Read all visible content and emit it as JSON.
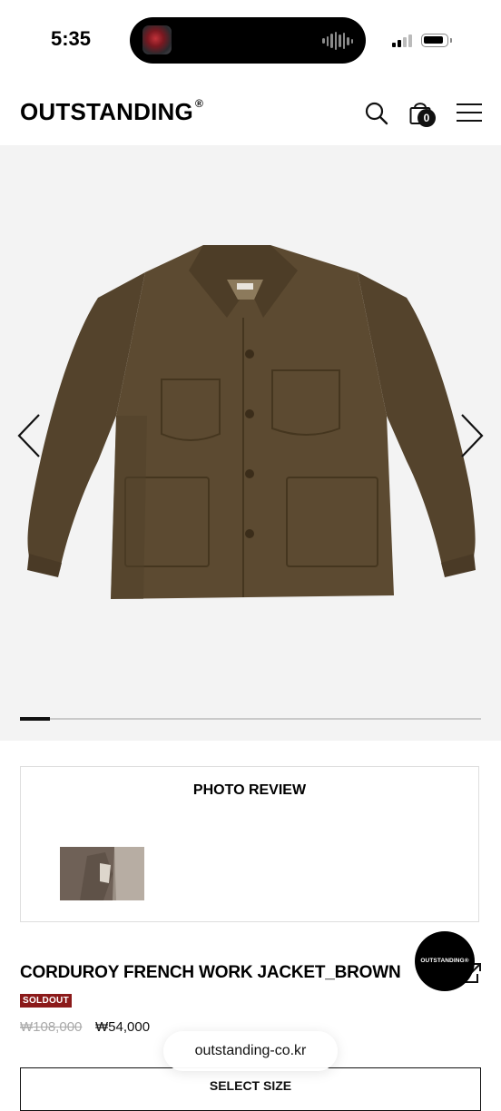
{
  "status_bar": {
    "time": "5:35"
  },
  "header": {
    "logo": "OUTSTANDING",
    "registered_mark": "®",
    "cart_count": "0"
  },
  "gallery": {
    "image": "brown-corduroy-jacket",
    "progress": 0.065
  },
  "photo_review": {
    "title": "PHOTO REVIEW"
  },
  "product": {
    "name": "CORDUROY FRENCH WORK JACKET_BROWN",
    "badge": "SOLDOUT",
    "original_price": "₩108,000",
    "sale_price": "₩54,000"
  },
  "brand_badge": {
    "text": "OUTSTANDING®"
  },
  "browser": {
    "url": "outstanding-co.kr"
  },
  "select_size": {
    "label": "SELECT SIZE"
  },
  "colors": {
    "soldout_bg": "#8b1a1a",
    "jacket": "#5a4a31",
    "accent": "#111111"
  }
}
